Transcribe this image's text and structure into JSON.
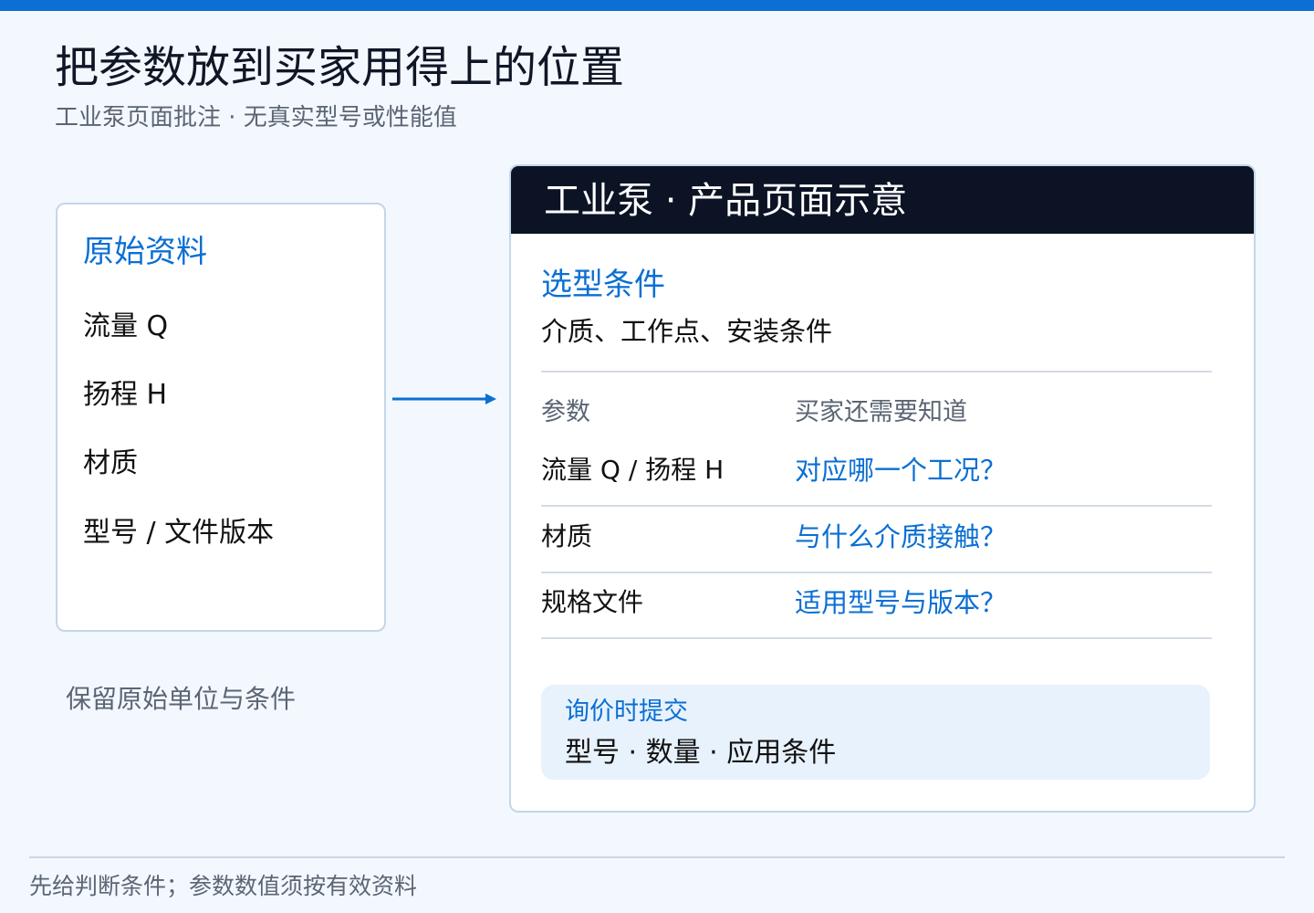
{
  "page": {
    "title": "把参数放到买家用得上的位置",
    "subtitle": "工业泵页面批注 · 无真实型号或性能值"
  },
  "source": {
    "title": "原始资料",
    "items": [
      "流量 Q",
      "扬程 H",
      "材质",
      "型号 / 文件版本"
    ],
    "note": "保留原始单位与条件"
  },
  "product": {
    "header": "工业泵 · 产品页面示意",
    "selection": {
      "title": "选型条件",
      "description": "介质、工作点、安装条件"
    },
    "table": {
      "headers": [
        "参数",
        "买家还需要知道"
      ],
      "rows": [
        {
          "param": "流量 Q / 扬程 H",
          "need": "对应哪一个工况？"
        },
        {
          "param": "材质",
          "need": "与什么介质接触？"
        },
        {
          "param": "规格文件",
          "need": "适用型号与版本？"
        }
      ]
    },
    "inquiry": {
      "title": "询价时提交",
      "items": "型号 · 数量 · 应用条件"
    }
  },
  "footer": {
    "note": "先给判断条件；参数数值须按有效资料"
  },
  "colors": {
    "accent": "#0b6fd3",
    "header_bg": "#0b1324",
    "page_bg": "#f3f8fe",
    "border": "#c3d6ea",
    "inquiry_bg": "#e8f2fd"
  }
}
